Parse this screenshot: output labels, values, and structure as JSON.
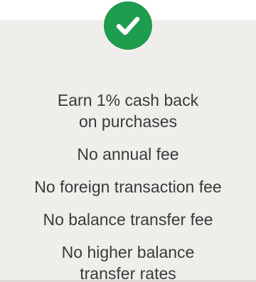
{
  "colors": {
    "check_badge": "#1f9d4f",
    "card_background": "#f0eeeb",
    "text": "#3a3a3a"
  },
  "icon": "checkmark-circle-icon",
  "features": [
    {
      "text": "Earn 1% cash back\non purchases"
    },
    {
      "text": "No annual fee"
    },
    {
      "text": "No foreign transaction fee"
    },
    {
      "text": "No balance transfer fee"
    },
    {
      "text": "No higher balance\ntransfer rates"
    }
  ]
}
